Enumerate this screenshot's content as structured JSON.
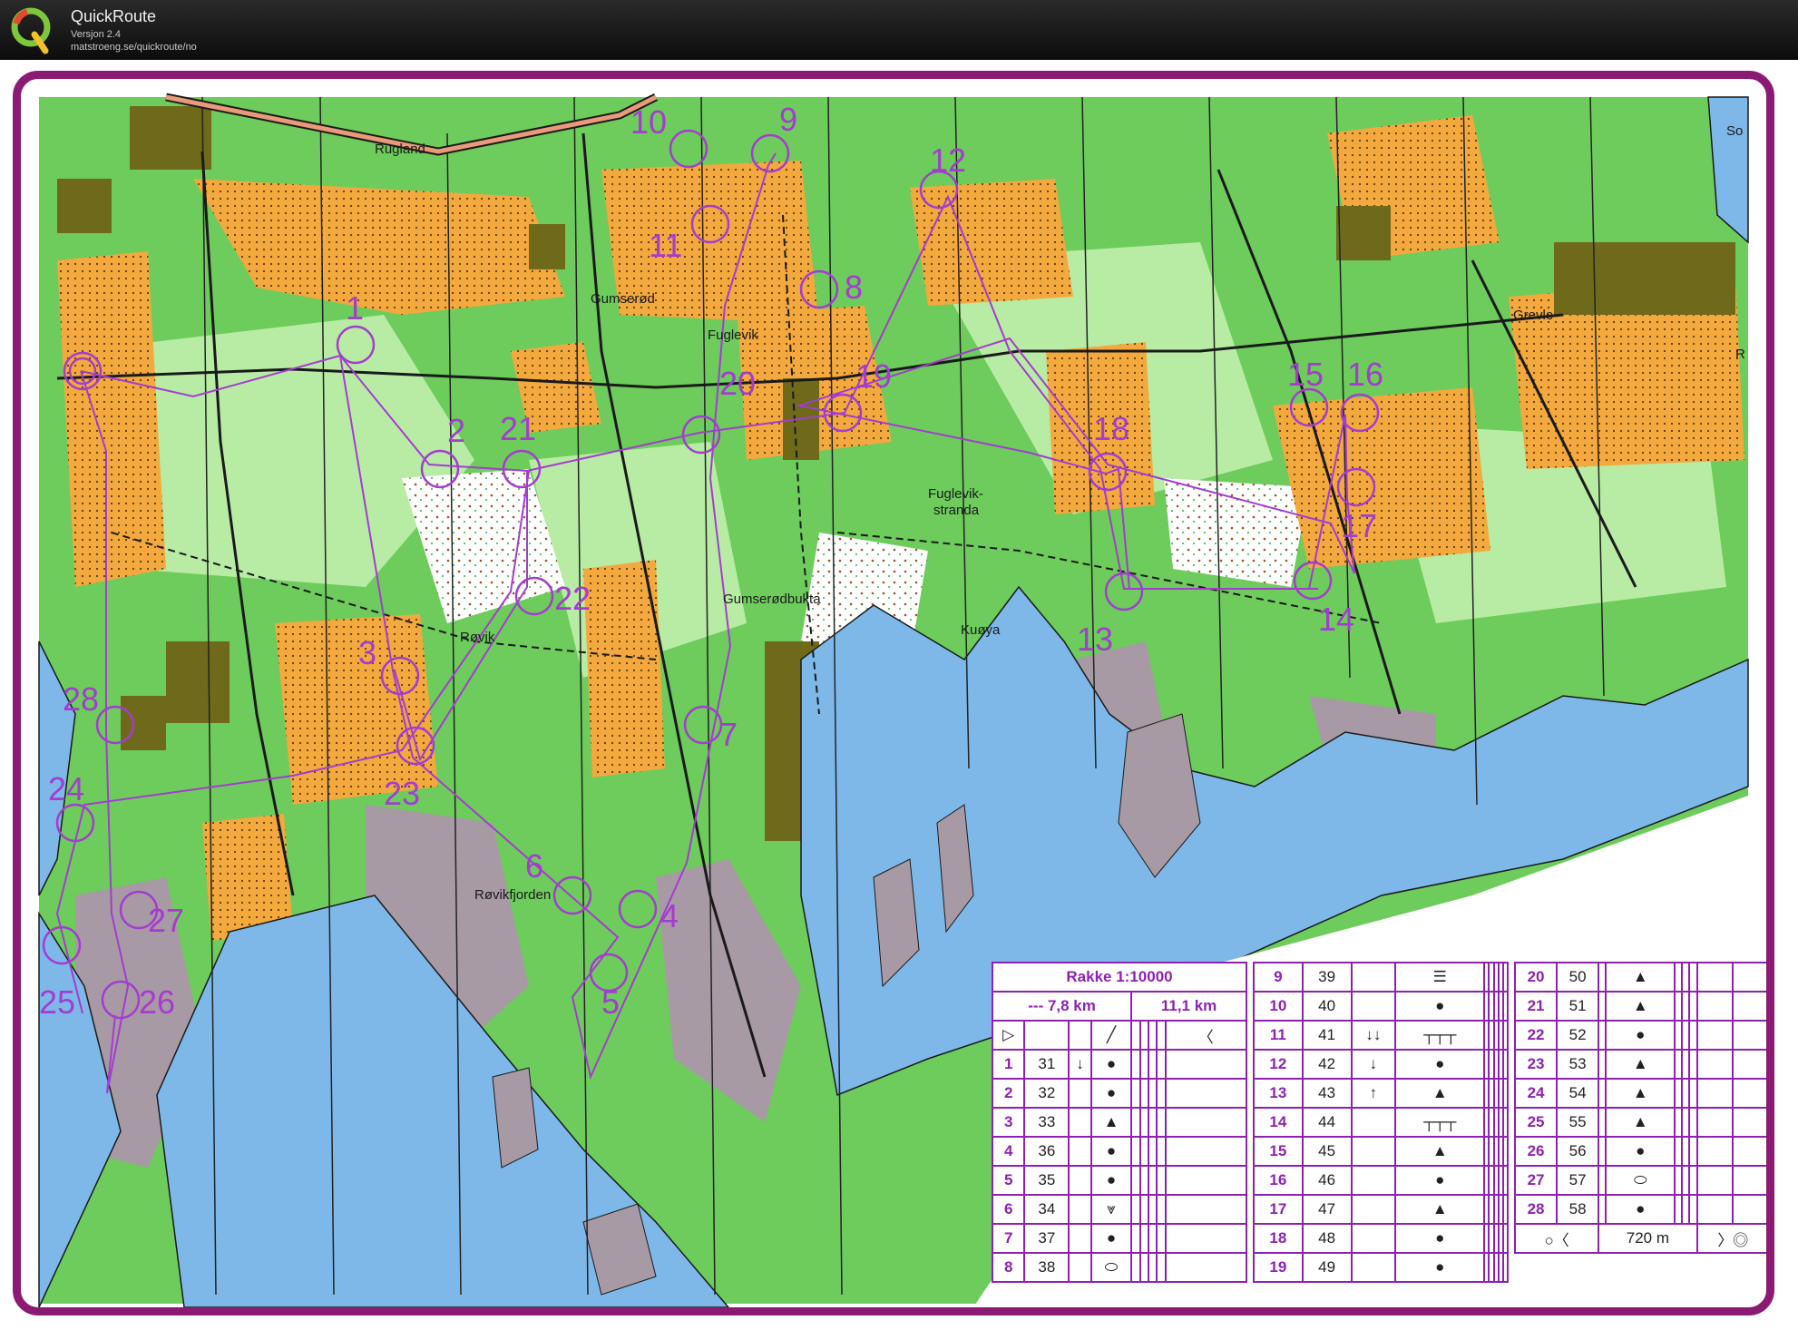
{
  "app": {
    "title": "QuickRoute",
    "version": "Versjon 2.4",
    "url": "matstroeng.se/quickroute/no"
  },
  "map": {
    "colors": {
      "frame": "#8a1a72",
      "course": "#a43cd0",
      "water": "#7db8e8",
      "open": "#f3a93d",
      "green": "#6dcc5c",
      "rock": "#a79aa4",
      "built": "#6e6a1a"
    },
    "place_names": {
      "rugland": "Rugland",
      "gumserod": "Gumserød",
      "fuglevik": "Fuglevik",
      "grevle": "Grevle",
      "rovik": "Røvik",
      "gumserodbukta": "Gumserødbukta",
      "kuoya": "Kuøya",
      "fuglevik_stranda_1": "Fuglevik-",
      "fuglevik_stranda_2": "stranda",
      "rovikfjorden": "Røvikfjorden",
      "so": "So",
      "r": "R"
    },
    "control_numbers": [
      "1",
      "2",
      "3",
      "4",
      "5",
      "6",
      "7",
      "8",
      "9",
      "10",
      "11",
      "12",
      "13",
      "14",
      "15",
      "16",
      "17",
      "18",
      "19",
      "20",
      "21",
      "22",
      "23",
      "24",
      "25",
      "26",
      "27",
      "28"
    ]
  },
  "description_sheet": {
    "title": "Rakke 1:10000",
    "distance_dashed": "--- 7,8 km",
    "distance_full": "11,1 km",
    "finish_distance": "720 m",
    "controls": [
      {
        "n": "1",
        "code": "31",
        "dir": "↓",
        "sym": "dot"
      },
      {
        "n": "2",
        "code": "32",
        "dir": "",
        "sym": "dot"
      },
      {
        "n": "3",
        "code": "33",
        "dir": "",
        "sym": "tri"
      },
      {
        "n": "4",
        "code": "36",
        "dir": "",
        "sym": "dot"
      },
      {
        "n": "5",
        "code": "35",
        "dir": "",
        "sym": "dot"
      },
      {
        "n": "6",
        "code": "34",
        "dir": "",
        "sym": "depression"
      },
      {
        "n": "7",
        "code": "37",
        "dir": "",
        "sym": "dot"
      },
      {
        "n": "8",
        "code": "38",
        "dir": "",
        "sym": "oval"
      },
      {
        "n": "9",
        "code": "39",
        "dir": "",
        "sym": "ruin"
      },
      {
        "n": "10",
        "code": "40",
        "dir": "",
        "sym": "dot"
      },
      {
        "n": "11",
        "code": "41",
        "dir": "↓↓",
        "sym": "fence"
      },
      {
        "n": "12",
        "code": "42",
        "dir": "↓",
        "sym": "dot"
      },
      {
        "n": "13",
        "code": "43",
        "dir": "↑",
        "sym": "tri"
      },
      {
        "n": "14",
        "code": "44",
        "dir": "",
        "sym": "fence"
      },
      {
        "n": "15",
        "code": "45",
        "dir": "",
        "sym": "tri"
      },
      {
        "n": "16",
        "code": "46",
        "dir": "",
        "sym": "dot"
      },
      {
        "n": "17",
        "code": "47",
        "dir": "",
        "sym": "tri"
      },
      {
        "n": "18",
        "code": "48",
        "dir": "",
        "sym": "dot"
      },
      {
        "n": "19",
        "code": "49",
        "dir": "",
        "sym": "dot"
      },
      {
        "n": "20",
        "code": "50",
        "dir": "",
        "sym": "tri"
      },
      {
        "n": "21",
        "code": "51",
        "dir": "",
        "sym": "tri"
      },
      {
        "n": "22",
        "code": "52",
        "dir": "",
        "sym": "dot"
      },
      {
        "n": "23",
        "code": "53",
        "dir": "",
        "sym": "tri"
      },
      {
        "n": "24",
        "code": "54",
        "dir": "",
        "sym": "tri"
      },
      {
        "n": "25",
        "code": "55",
        "dir": "",
        "sym": "tri"
      },
      {
        "n": "26",
        "code": "56",
        "dir": "",
        "sym": "dot"
      },
      {
        "n": "27",
        "code": "57",
        "dir": "",
        "sym": "oval"
      },
      {
        "n": "28",
        "code": "58",
        "dir": "",
        "sym": "dot"
      }
    ]
  }
}
